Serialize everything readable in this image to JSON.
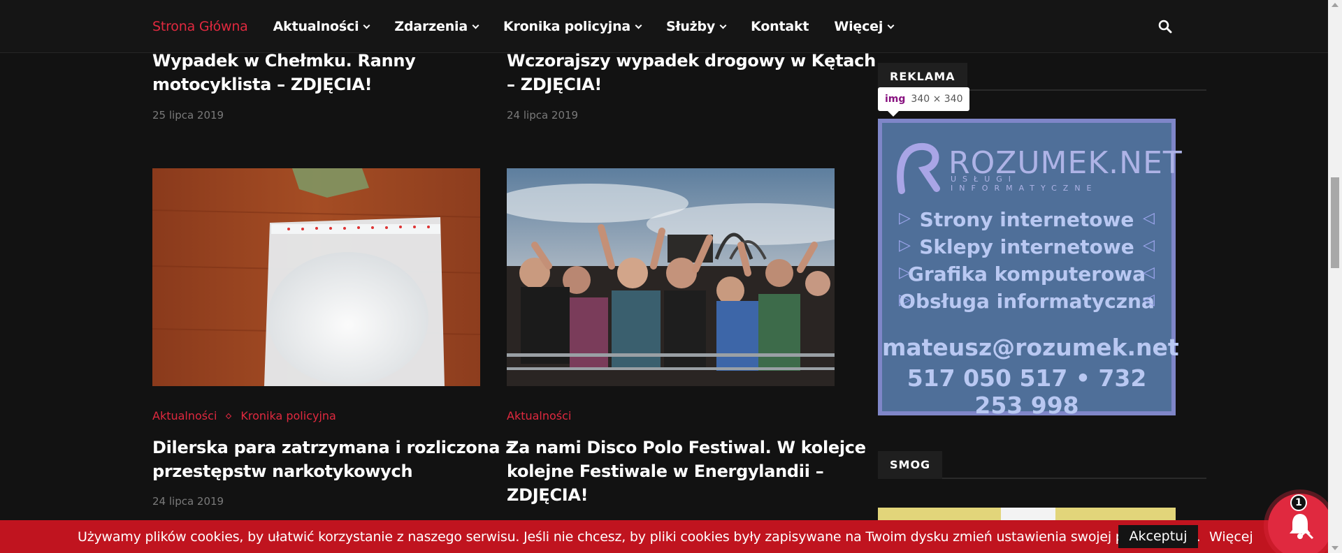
{
  "nav": {
    "items": [
      {
        "label": "Strona Główna",
        "active": true,
        "dropdown": false
      },
      {
        "label": "Aktualności",
        "active": false,
        "dropdown": true
      },
      {
        "label": "Zdarzenia",
        "active": false,
        "dropdown": true
      },
      {
        "label": "Kronika policyjna",
        "active": false,
        "dropdown": true
      },
      {
        "label": "Służby",
        "active": false,
        "dropdown": true
      },
      {
        "label": "Kontakt",
        "active": false,
        "dropdown": false
      },
      {
        "label": "Więcej",
        "active": false,
        "dropdown": true
      }
    ],
    "search_icon": "search-icon"
  },
  "posts": [
    {
      "title_line1": "Wypadek w Chełmku. Ranny",
      "title_line2": "motocyklista – ZDJĘCIA!",
      "date": "25 lipca 2019"
    },
    {
      "title_line1": "Wczorajszy wypadek drogowy w Kętach",
      "title_line2": "– ZDJĘCIA!",
      "date": "24 lipca 2019"
    },
    {
      "categories": [
        "Aktualności",
        "Kronika policyjna"
      ],
      "title_line1": "Dilerska para zatrzymana i rozliczona z",
      "title_line2": "przestępstw narkotykowych",
      "date": "24 lipca 2019"
    },
    {
      "categories": [
        "Aktualności"
      ],
      "title_line1": "Za nami Disco Polo Festiwal. W kolejce",
      "title_line2": "kolejne Festiwale w Energylandii –",
      "title_line3": "ZDJĘCIA!"
    }
  ],
  "sidebar": {
    "ad_heading": "REKLAMA",
    "smog_heading": "SMOG",
    "tooltip": {
      "tag": "img",
      "size": "340 × 340"
    },
    "ad": {
      "brand": "ROZUMEK.NET",
      "tagline": "USŁUGI INFORMATYCZNE",
      "services": [
        "Strony internetowe",
        "Sklepy internetowe",
        "Grafika komputerowa",
        "Obsługa informatyczna"
      ],
      "email": "mateusz@rozumek.net",
      "phones": "517 050 517 • 732 253 998"
    }
  },
  "cookie": {
    "text": "Używamy plików cookies, by ułatwić korzystanie z naszego serwisu. Jeśli nie chcesz, by pliki cookies były zapisywane na Twoim dysku zmień ustawienia swojej przeglądarki.",
    "accept": "Akceptuj",
    "more": "Więcej"
  },
  "notification": {
    "count": "1"
  },
  "colors": {
    "accent": "#e0293f",
    "background": "#121212",
    "cookie_bar": "#c0141f"
  }
}
